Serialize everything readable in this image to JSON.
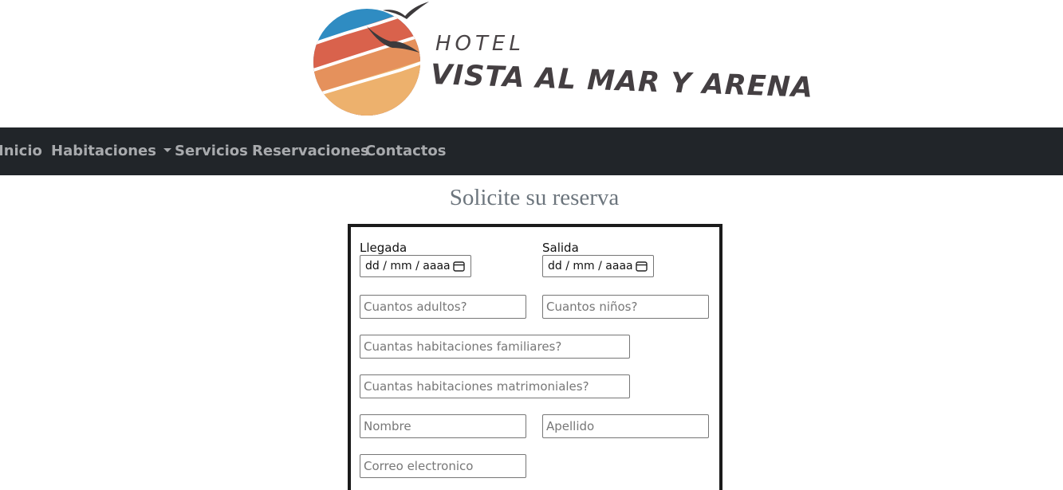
{
  "header": {
    "logo_hotel": "HOTEL",
    "logo_name": "VISTA AL MAR Y ARENA",
    "colors": {
      "blue": "#2f8cc2",
      "red": "#d9624c",
      "orange": "#e5915c",
      "sand": "#edb16d",
      "bird": "#3d3a3c"
    }
  },
  "nav": {
    "items": [
      {
        "label": "Inicio"
      },
      {
        "label": "Habitaciones",
        "dropdown": true
      },
      {
        "label": "Servicios"
      },
      {
        "label": "Reservaciones"
      },
      {
        "label": "Contactos"
      }
    ]
  },
  "page": {
    "title": "Solicite su reserva"
  },
  "form": {
    "arrival_label": "Llegada",
    "arrival_value": "dd / mm / aaaa",
    "departure_label": "Salida",
    "departure_value": "dd / mm / aaaa",
    "adults_placeholder": "Cuantos adultos?",
    "children_placeholder": "Cuantos niños?",
    "family_rooms_placeholder": "Cuantas habitaciones familiares?",
    "double_rooms_placeholder": "Cuantas habitaciones matrimoniales?",
    "first_name_placeholder": "Nombre",
    "last_name_placeholder": "Apellido",
    "email_placeholder": "Correo electronico"
  }
}
